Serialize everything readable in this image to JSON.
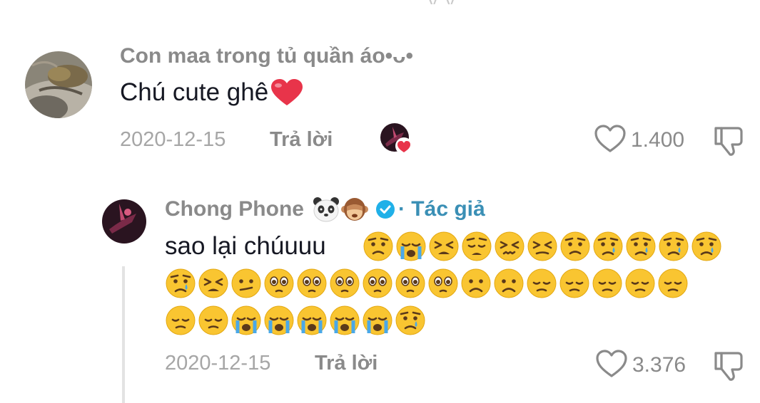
{
  "top_fragment": "y y",
  "comment": {
    "username": "Con maa trong tủ quần áo•ᴗ•",
    "text": "Chú cute ghê",
    "date": "2020-12-15",
    "reply_label": "Trả lời",
    "likes": "1.400"
  },
  "reply": {
    "username": "Chong Phone",
    "author_label": "· Tác giả",
    "text": "sao lại chúuuu",
    "emoji_rows": [
      [
        "worried",
        "sob",
        "tired",
        "weary",
        "confounded",
        "persevere",
        "worried",
        "cry",
        "cry",
        "cry",
        "cry"
      ],
      [
        "cry",
        "tired",
        "confused",
        "pleading",
        "pleading",
        "pleading",
        "pleading",
        "pleading",
        "pleading",
        "frown",
        "frown",
        "disappointed",
        "disappointed",
        "disappointed",
        "disappointed",
        "disappointed"
      ],
      [
        "disappointed",
        "disappointed",
        "sob",
        "sob",
        "sob",
        "sob",
        "sob",
        "cry"
      ]
    ],
    "date": "2020-12-15",
    "reply_label": "Trả lời",
    "likes": "3.376"
  },
  "colors": {
    "text_primary": "#161823",
    "text_secondary": "#8a8a8a",
    "verified_blue": "#20b0e8",
    "heart_red": "#e8344a",
    "emoji_yellow": "#f9c531",
    "tear_blue": "#4aa8e8"
  },
  "icons": [
    "heart-emoji",
    "liked-by-creator-avatar",
    "like-heart-icon",
    "dislike-icon",
    "panda-emoji",
    "monkey-emoji",
    "verified-badge-icon"
  ]
}
